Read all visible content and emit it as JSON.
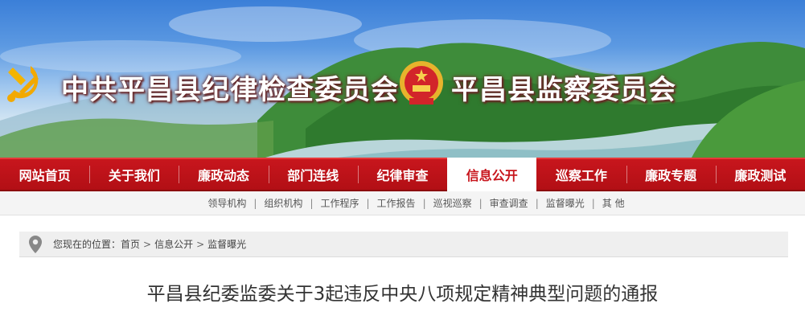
{
  "banner": {
    "title_left": "中共平昌县纪律检查委员会",
    "title_right": "平昌县监察委员会"
  },
  "nav": {
    "items": [
      {
        "label": "网站首页"
      },
      {
        "label": "关于我们"
      },
      {
        "label": "廉政动态"
      },
      {
        "label": "部门连线"
      },
      {
        "label": "纪律审查"
      },
      {
        "label": "信息公开",
        "active": true
      },
      {
        "label": "巡察工作"
      },
      {
        "label": "廉政专题"
      },
      {
        "label": "廉政测试"
      }
    ]
  },
  "subnav": {
    "items": [
      "领导机构",
      "组织机构",
      "工作程序",
      "工作报告",
      "巡视巡察",
      "审查调查",
      "监督曝光",
      "其 他"
    ]
  },
  "breadcrumb": {
    "prefix": "您现在的位置：",
    "items": [
      "首页",
      "信息公开",
      "监督曝光"
    ]
  },
  "article": {
    "title": "平昌县纪委监委关于3起违反中央八项规定精神典型问题的通报"
  },
  "colors": {
    "nav_red": "#c8161d",
    "title_text": "#333333"
  },
  "icons": {
    "party": "party-emblem-icon",
    "nation": "national-emblem-icon",
    "location": "location-pin-icon"
  }
}
